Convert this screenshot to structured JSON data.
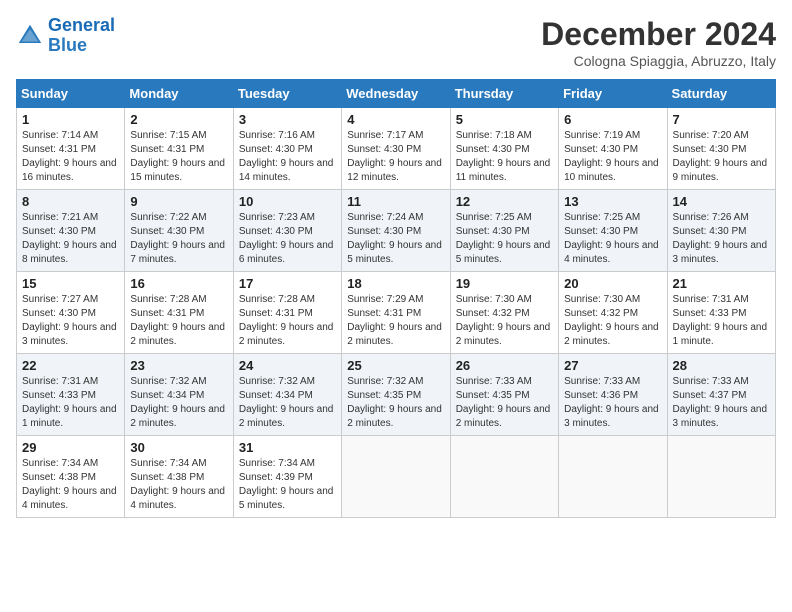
{
  "logo": {
    "line1": "General",
    "line2": "Blue"
  },
  "title": "December 2024",
  "location": "Cologna Spiaggia, Abruzzo, Italy",
  "days_header": [
    "Sunday",
    "Monday",
    "Tuesday",
    "Wednesday",
    "Thursday",
    "Friday",
    "Saturday"
  ],
  "weeks": [
    [
      {
        "num": "1",
        "sunrise": "7:14 AM",
        "sunset": "4:31 PM",
        "daylight": "9 hours and 16 minutes."
      },
      {
        "num": "2",
        "sunrise": "7:15 AM",
        "sunset": "4:31 PM",
        "daylight": "9 hours and 15 minutes."
      },
      {
        "num": "3",
        "sunrise": "7:16 AM",
        "sunset": "4:30 PM",
        "daylight": "9 hours and 14 minutes."
      },
      {
        "num": "4",
        "sunrise": "7:17 AM",
        "sunset": "4:30 PM",
        "daylight": "9 hours and 12 minutes."
      },
      {
        "num": "5",
        "sunrise": "7:18 AM",
        "sunset": "4:30 PM",
        "daylight": "9 hours and 11 minutes."
      },
      {
        "num": "6",
        "sunrise": "7:19 AM",
        "sunset": "4:30 PM",
        "daylight": "9 hours and 10 minutes."
      },
      {
        "num": "7",
        "sunrise": "7:20 AM",
        "sunset": "4:30 PM",
        "daylight": "9 hours and 9 minutes."
      }
    ],
    [
      {
        "num": "8",
        "sunrise": "7:21 AM",
        "sunset": "4:30 PM",
        "daylight": "9 hours and 8 minutes."
      },
      {
        "num": "9",
        "sunrise": "7:22 AM",
        "sunset": "4:30 PM",
        "daylight": "9 hours and 7 minutes."
      },
      {
        "num": "10",
        "sunrise": "7:23 AM",
        "sunset": "4:30 PM",
        "daylight": "9 hours and 6 minutes."
      },
      {
        "num": "11",
        "sunrise": "7:24 AM",
        "sunset": "4:30 PM",
        "daylight": "9 hours and 5 minutes."
      },
      {
        "num": "12",
        "sunrise": "7:25 AM",
        "sunset": "4:30 PM",
        "daylight": "9 hours and 5 minutes."
      },
      {
        "num": "13",
        "sunrise": "7:25 AM",
        "sunset": "4:30 PM",
        "daylight": "9 hours and 4 minutes."
      },
      {
        "num": "14",
        "sunrise": "7:26 AM",
        "sunset": "4:30 PM",
        "daylight": "9 hours and 3 minutes."
      }
    ],
    [
      {
        "num": "15",
        "sunrise": "7:27 AM",
        "sunset": "4:30 PM",
        "daylight": "9 hours and 3 minutes."
      },
      {
        "num": "16",
        "sunrise": "7:28 AM",
        "sunset": "4:31 PM",
        "daylight": "9 hours and 2 minutes."
      },
      {
        "num": "17",
        "sunrise": "7:28 AM",
        "sunset": "4:31 PM",
        "daylight": "9 hours and 2 minutes."
      },
      {
        "num": "18",
        "sunrise": "7:29 AM",
        "sunset": "4:31 PM",
        "daylight": "9 hours and 2 minutes."
      },
      {
        "num": "19",
        "sunrise": "7:30 AM",
        "sunset": "4:32 PM",
        "daylight": "9 hours and 2 minutes."
      },
      {
        "num": "20",
        "sunrise": "7:30 AM",
        "sunset": "4:32 PM",
        "daylight": "9 hours and 2 minutes."
      },
      {
        "num": "21",
        "sunrise": "7:31 AM",
        "sunset": "4:33 PM",
        "daylight": "9 hours and 1 minute."
      }
    ],
    [
      {
        "num": "22",
        "sunrise": "7:31 AM",
        "sunset": "4:33 PM",
        "daylight": "9 hours and 1 minute."
      },
      {
        "num": "23",
        "sunrise": "7:32 AM",
        "sunset": "4:34 PM",
        "daylight": "9 hours and 2 minutes."
      },
      {
        "num": "24",
        "sunrise": "7:32 AM",
        "sunset": "4:34 PM",
        "daylight": "9 hours and 2 minutes."
      },
      {
        "num": "25",
        "sunrise": "7:32 AM",
        "sunset": "4:35 PM",
        "daylight": "9 hours and 2 minutes."
      },
      {
        "num": "26",
        "sunrise": "7:33 AM",
        "sunset": "4:35 PM",
        "daylight": "9 hours and 2 minutes."
      },
      {
        "num": "27",
        "sunrise": "7:33 AM",
        "sunset": "4:36 PM",
        "daylight": "9 hours and 3 minutes."
      },
      {
        "num": "28",
        "sunrise": "7:33 AM",
        "sunset": "4:37 PM",
        "daylight": "9 hours and 3 minutes."
      }
    ],
    [
      {
        "num": "29",
        "sunrise": "7:34 AM",
        "sunset": "4:38 PM",
        "daylight": "9 hours and 4 minutes."
      },
      {
        "num": "30",
        "sunrise": "7:34 AM",
        "sunset": "4:38 PM",
        "daylight": "9 hours and 4 minutes."
      },
      {
        "num": "31",
        "sunrise": "7:34 AM",
        "sunset": "4:39 PM",
        "daylight": "9 hours and 5 minutes."
      },
      null,
      null,
      null,
      null
    ]
  ]
}
